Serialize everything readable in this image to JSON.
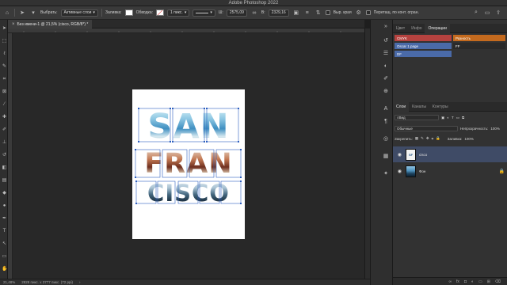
{
  "app": {
    "title": "Adobe Photoshop 2022"
  },
  "options_bar": {
    "select_label": "Выбрать:",
    "select_value": "Активные слои",
    "fill_label": "Заливка:",
    "stroke_label": "Обводка:",
    "stroke_width": "1 пикс.",
    "width_label": "Ш:",
    "width_value": "2575,09",
    "height_label": "В:",
    "height_value": "2329,16",
    "align_edges": "Выр. края",
    "constrain": "Перетащ. по конт. огран."
  },
  "document": {
    "tab_title": "Без имени-1 @ 21,5% (cisco, RGB/8*) *",
    "art_words": [
      "SAN",
      "FRAN",
      "CISCO"
    ]
  },
  "status_bar": {
    "zoom": "21,48%",
    "doc_size": "2828 пикс. x 3777 пикс. (72 ppi)"
  },
  "panels": {
    "top_tabs": [
      "Цвет",
      "Инфо",
      "Операции"
    ],
    "actions": [
      {
        "label": "CMYK",
        "color": "#b5423f"
      },
      {
        "label": "Разность",
        "color": "#c46a1e"
      },
      {
        "label": "Oscar 1 page",
        "color": "#4a6aa8"
      },
      {
        "label": "FF",
        "color": "#2a2a2a"
      },
      {
        "label": "DF",
        "color": "#4a6aa8"
      }
    ],
    "layer_tabs": [
      "Слои",
      "Каналы",
      "Контуры"
    ],
    "kind_filter": "Вид",
    "blend_mode": "Обычные",
    "opacity_label": "Непрозрачность:",
    "opacity_value": "100%",
    "lock_label": "Закрепить:",
    "fill_label": "Заливка:",
    "fill_value": "100%",
    "layers": [
      {
        "name": "cisco",
        "selected": true
      },
      {
        "name": "Фон",
        "selected": false
      }
    ]
  },
  "colors": {
    "selection": "#3f4b66",
    "accent": "#2e5fbf"
  }
}
